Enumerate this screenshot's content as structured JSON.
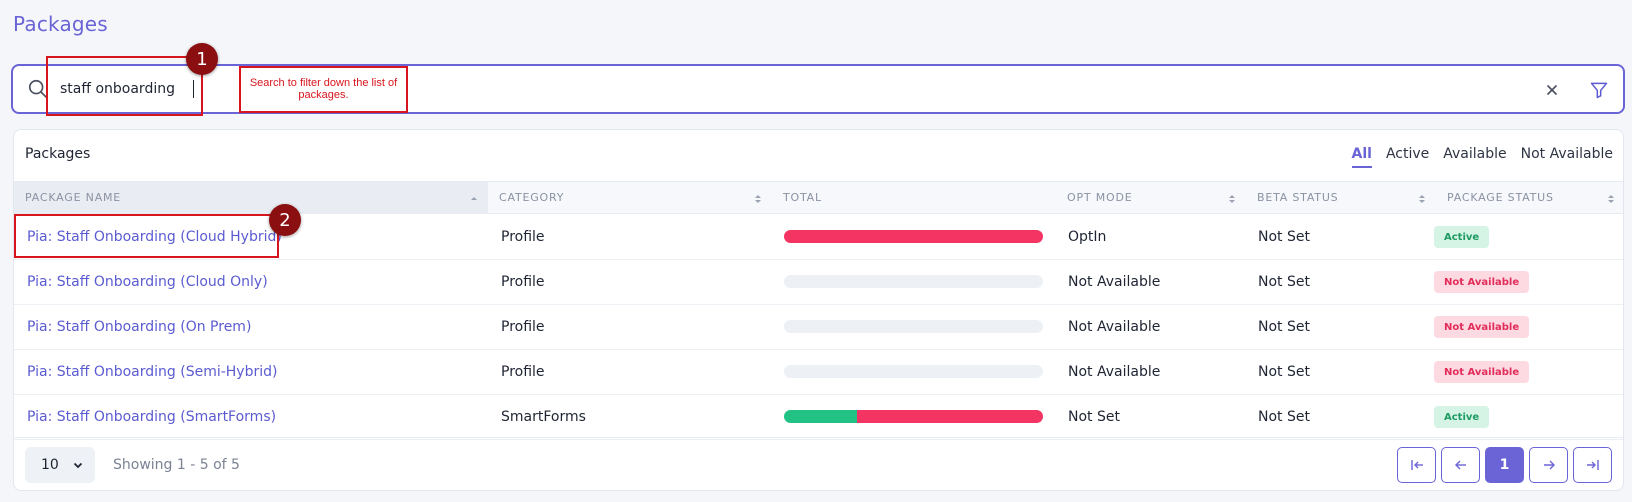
{
  "page": {
    "title": "Packages"
  },
  "search": {
    "value": "staff onboarding",
    "placeholder": "",
    "tooltip": "Search to filter down the list of packages."
  },
  "annotations": {
    "badge1": "1",
    "badge2": "2"
  },
  "card": {
    "title": "Packages",
    "filters": [
      "All",
      "Active",
      "Available",
      "Not Available"
    ],
    "active_filter": "All"
  },
  "table": {
    "columns": [
      "PACKAGE NAME",
      "CATEGORY",
      "TOTAL",
      "OPT MODE",
      "BETA STATUS",
      "PACKAGE STATUS"
    ],
    "rows": [
      {
        "name": "Pia: Staff Onboarding (Cloud Hybrid)",
        "category": "Profile",
        "total": [
          {
            "value": 1.0,
            "color": "#f43563"
          }
        ],
        "opt_mode": "OptIn",
        "beta": "Not Set",
        "status": "Active",
        "status_kind": "active"
      },
      {
        "name": "Pia: Staff Onboarding (Cloud Only)",
        "category": "Profile",
        "total": [],
        "opt_mode": "Not Available",
        "beta": "Not Set",
        "status": "Not Available",
        "status_kind": "na"
      },
      {
        "name": "Pia: Staff Onboarding (On Prem)",
        "category": "Profile",
        "total": [],
        "opt_mode": "Not Available",
        "beta": "Not Set",
        "status": "Not Available",
        "status_kind": "na"
      },
      {
        "name": "Pia: Staff Onboarding (Semi-Hybrid)",
        "category": "Profile",
        "total": [],
        "opt_mode": "Not Available",
        "beta": "Not Set",
        "status": "Not Available",
        "status_kind": "na"
      },
      {
        "name": "Pia: Staff Onboarding (SmartForms)",
        "category": "SmartForms",
        "total": [
          {
            "value": 0.28,
            "color": "#21c284"
          },
          {
            "value": 0.72,
            "color": "#f43563"
          }
        ],
        "opt_mode": "Not Set",
        "beta": "Not Set",
        "status": "Active",
        "status_kind": "active"
      }
    ]
  },
  "footer": {
    "page_size": "10",
    "showing": "Showing 1 - 5 of 5",
    "current_page": "1"
  },
  "colors": {
    "accent": "#6a64d6",
    "annotation": "#d8151d",
    "badge_dark": "#8b0f10"
  }
}
